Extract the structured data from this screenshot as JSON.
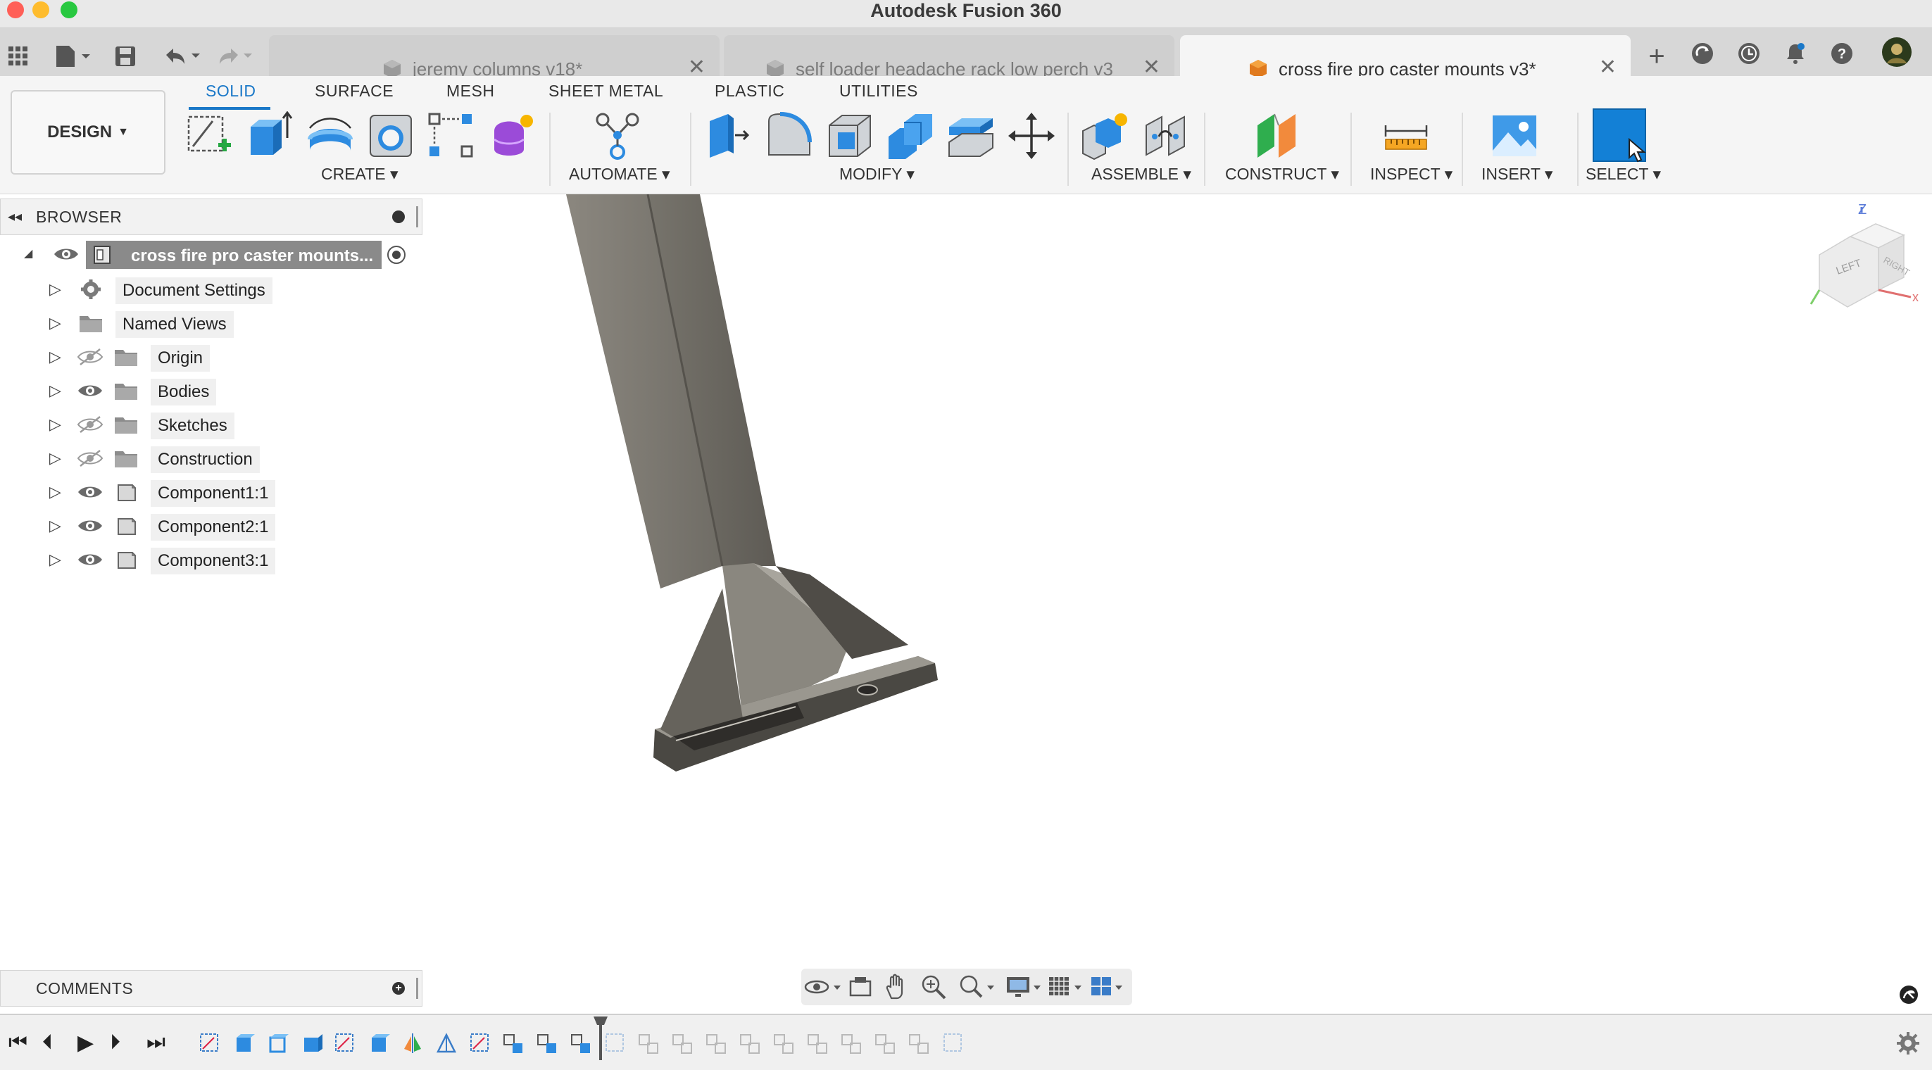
{
  "app": {
    "title": "Autodesk Fusion 360"
  },
  "tabs": [
    {
      "label": "jeremy columns v18*",
      "active": false
    },
    {
      "label": "self loader headache rack low perch v3",
      "active": false
    },
    {
      "label": "cross fire pro caster mounts v3*",
      "active": true
    }
  ],
  "ribbon": {
    "workspace": "DESIGN",
    "workspace_tabs": [
      "SOLID",
      "SURFACE",
      "MESH",
      "SHEET METAL",
      "PLASTIC",
      "UTILITIES"
    ],
    "groups": [
      "CREATE",
      "AUTOMATE",
      "MODIFY",
      "ASSEMBLE",
      "CONSTRUCT",
      "INSPECT",
      "INSERT",
      "SELECT"
    ]
  },
  "browser": {
    "title": "BROWSER",
    "root": "cross fire pro caster mounts...",
    "items": [
      {
        "label": "Document Settings",
        "icon": "gear-icon",
        "visible": null
      },
      {
        "label": "Named Views",
        "icon": "folder-icon",
        "visible": null
      },
      {
        "label": "Origin",
        "icon": "folder-icon",
        "visible": false
      },
      {
        "label": "Bodies",
        "icon": "folder-icon",
        "visible": true
      },
      {
        "label": "Sketches",
        "icon": "folder-icon",
        "visible": false
      },
      {
        "label": "Construction",
        "icon": "folder-icon",
        "visible": false
      },
      {
        "label": "Component1:1",
        "icon": "component-icon",
        "visible": true
      },
      {
        "label": "Component2:1",
        "icon": "component-icon",
        "visible": true
      },
      {
        "label": "Component3:1",
        "icon": "component-icon",
        "visible": true
      }
    ]
  },
  "comments": {
    "title": "COMMENTS"
  },
  "viewcube": {
    "left_face": "LEFT",
    "front_face": "RIGHT",
    "z_label": "Z"
  },
  "colors": {
    "accent": "#1a78c8",
    "select_blue": "#1380d6",
    "model": "#7d7a72"
  }
}
